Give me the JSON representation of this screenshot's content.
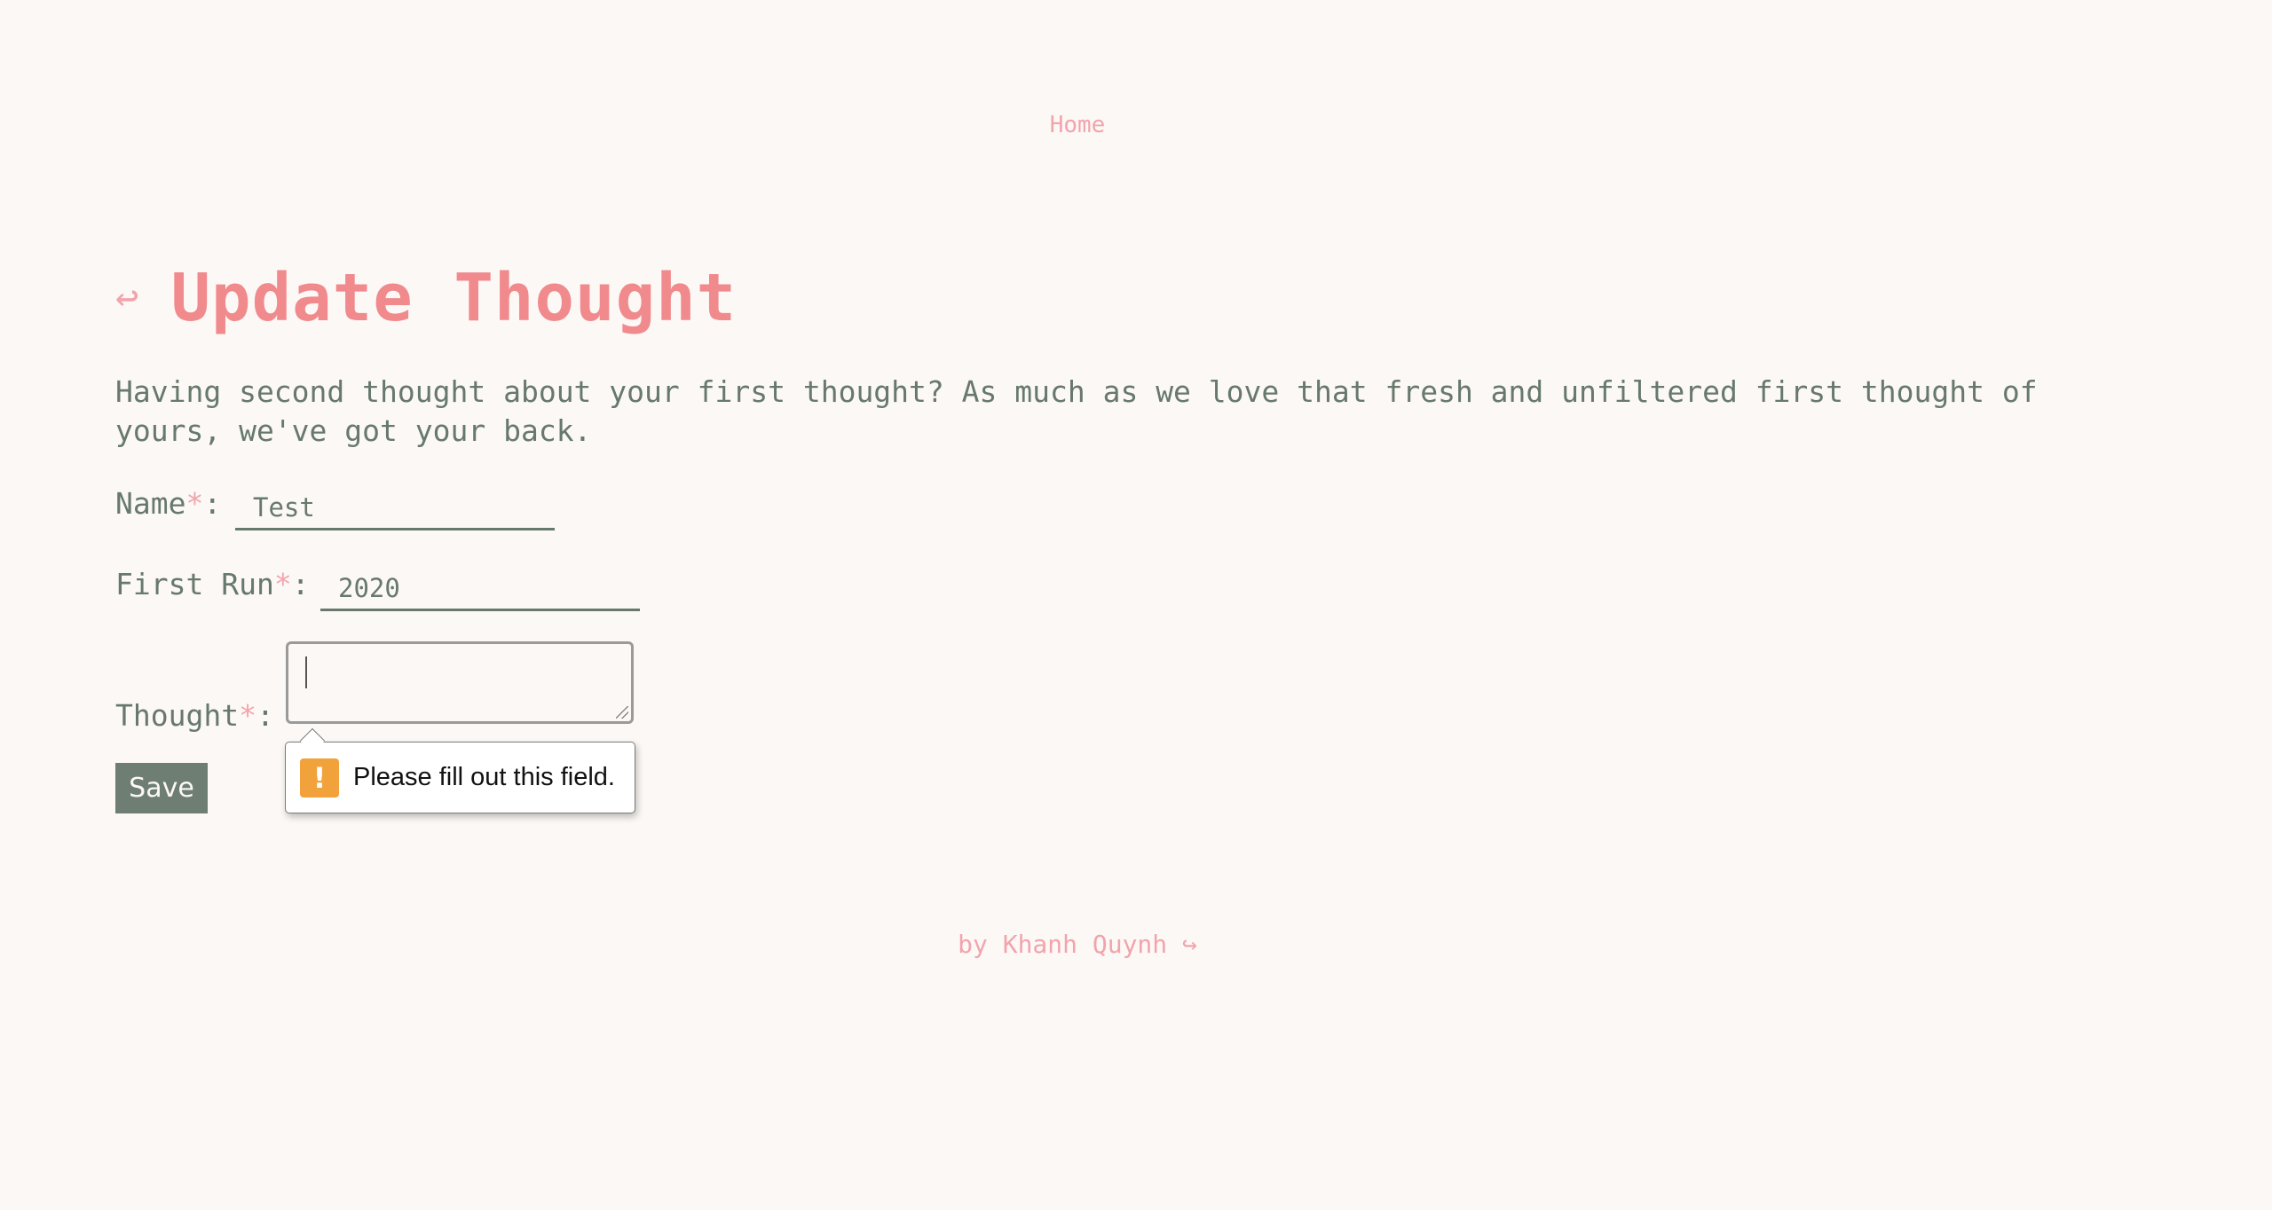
{
  "nav": {
    "home_label": "Home"
  },
  "header": {
    "back_glyph": "↩",
    "title": "Update Thought"
  },
  "description": "Having second thought about your first thought? As much as we love that fresh and unfiltered first thought of yours, we've got your back.",
  "form": {
    "name": {
      "label": "Name",
      "required_mark": "*",
      "colon": ":",
      "value": "Test"
    },
    "first_run": {
      "label": "First Run",
      "required_mark": "*",
      "colon": ":",
      "value": "2020"
    },
    "thought": {
      "label": "Thought",
      "required_mark": "*",
      "colon": ":",
      "value": ""
    },
    "save_label": "Save"
  },
  "validation": {
    "icon_glyph": "!",
    "message": "Please fill out this field."
  },
  "footer": {
    "credit": "by Khanh Quynh ↪"
  },
  "colors": {
    "background": "#fcf8f5",
    "title": "#f08a8d",
    "accent_pink": "#f2a4ad",
    "text_green": "#67796c",
    "button_bg": "#6e7e72",
    "warning": "#f2a23a"
  }
}
